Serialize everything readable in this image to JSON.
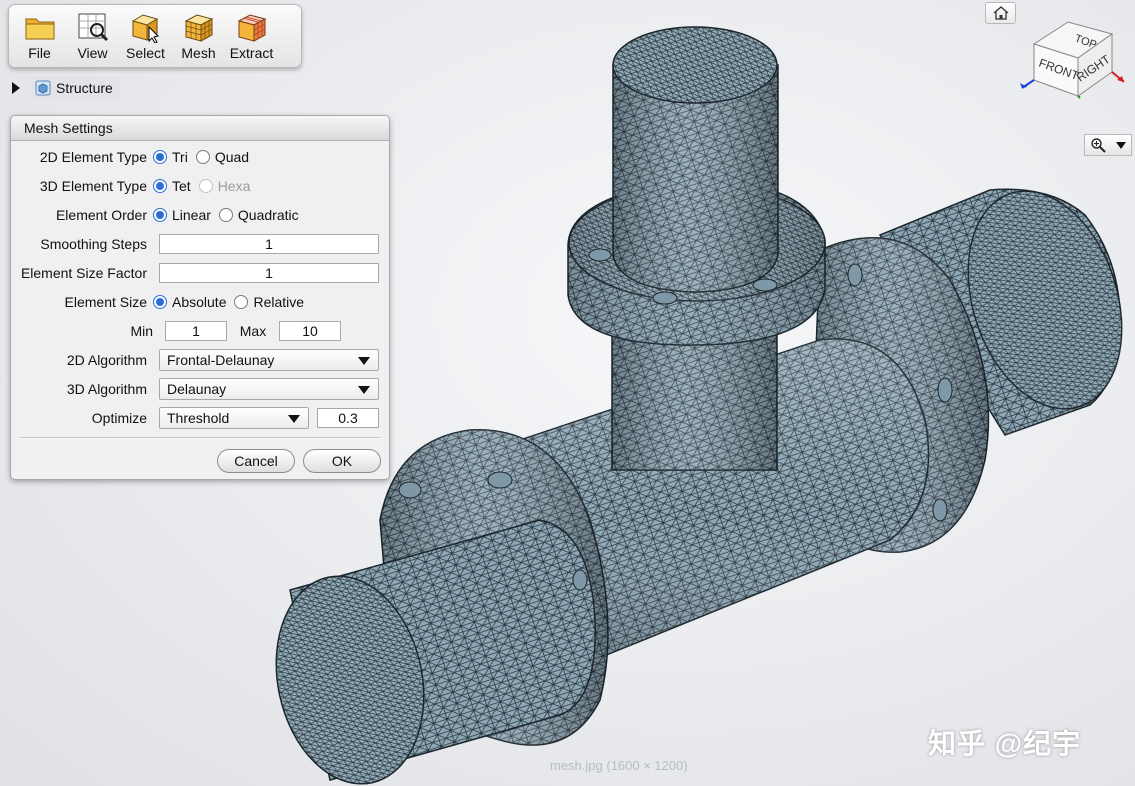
{
  "toolbar": {
    "buttons": [
      {
        "label": "File",
        "icon": "folder-icon"
      },
      {
        "label": "View",
        "icon": "view-magnifier-icon"
      },
      {
        "label": "Select",
        "icon": "select-cube-icon"
      },
      {
        "label": "Mesh",
        "icon": "mesh-cube-icon"
      },
      {
        "label": "Extract",
        "icon": "extract-cube-icon"
      }
    ]
  },
  "tree": {
    "label": "Structure",
    "icon": "structure-icon"
  },
  "mesh_settings": {
    "title": "Mesh Settings",
    "element_type_2d": {
      "label": "2D Element Type",
      "options": [
        "Tri",
        "Quad"
      ],
      "selected": "Tri"
    },
    "element_type_3d": {
      "label": "3D Element Type",
      "options": [
        "Tet",
        "Hexa"
      ],
      "selected": "Tet",
      "disabled": [
        "Hexa"
      ]
    },
    "element_order": {
      "label": "Element Order",
      "options": [
        "Linear",
        "Quadratic"
      ],
      "selected": "Linear"
    },
    "smoothing_steps": {
      "label": "Smoothing Steps",
      "value": "1"
    },
    "element_size_factor": {
      "label": "Element Size Factor",
      "value": "1"
    },
    "element_size": {
      "label": "Element Size",
      "options": [
        "Absolute",
        "Relative"
      ],
      "selected": "Absolute"
    },
    "min": {
      "label": "Min",
      "value": "1"
    },
    "max": {
      "label": "Max",
      "value": "10"
    },
    "algorithm_2d": {
      "label": "2D Algorithm",
      "value": "Frontal-Delaunay"
    },
    "algorithm_3d": {
      "label": "3D Algorithm",
      "value": "Delaunay"
    },
    "optimize": {
      "label": "Optimize",
      "value": "Threshold",
      "threshold": "0.3"
    },
    "cancel_label": "Cancel",
    "ok_label": "OK"
  },
  "nav_cube": {
    "top": "TOP",
    "front": "FRONT",
    "right": "RIGHT"
  },
  "watermark": "知乎 @纪宇",
  "caption": "mesh.jpg (1600 × 1200)",
  "colors": {
    "mesh_fill": "#8ea7b6",
    "mesh_line": "#243038",
    "accent": "#2a6fd6"
  }
}
